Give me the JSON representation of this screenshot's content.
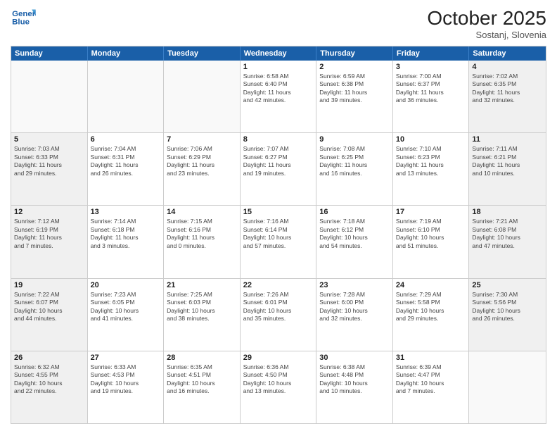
{
  "header": {
    "logo_line1": "General",
    "logo_line2": "Blue",
    "month": "October 2025",
    "location": "Sostanj, Slovenia"
  },
  "weekdays": [
    "Sunday",
    "Monday",
    "Tuesday",
    "Wednesday",
    "Thursday",
    "Friday",
    "Saturday"
  ],
  "weeks": [
    [
      {
        "day": "",
        "info": ""
      },
      {
        "day": "",
        "info": ""
      },
      {
        "day": "",
        "info": ""
      },
      {
        "day": "1",
        "info": "Sunrise: 6:58 AM\nSunset: 6:40 PM\nDaylight: 11 hours\nand 42 minutes."
      },
      {
        "day": "2",
        "info": "Sunrise: 6:59 AM\nSunset: 6:38 PM\nDaylight: 11 hours\nand 39 minutes."
      },
      {
        "day": "3",
        "info": "Sunrise: 7:00 AM\nSunset: 6:37 PM\nDaylight: 11 hours\nand 36 minutes."
      },
      {
        "day": "4",
        "info": "Sunrise: 7:02 AM\nSunset: 6:35 PM\nDaylight: 11 hours\nand 32 minutes."
      }
    ],
    [
      {
        "day": "5",
        "info": "Sunrise: 7:03 AM\nSunset: 6:33 PM\nDaylight: 11 hours\nand 29 minutes."
      },
      {
        "day": "6",
        "info": "Sunrise: 7:04 AM\nSunset: 6:31 PM\nDaylight: 11 hours\nand 26 minutes."
      },
      {
        "day": "7",
        "info": "Sunrise: 7:06 AM\nSunset: 6:29 PM\nDaylight: 11 hours\nand 23 minutes."
      },
      {
        "day": "8",
        "info": "Sunrise: 7:07 AM\nSunset: 6:27 PM\nDaylight: 11 hours\nand 19 minutes."
      },
      {
        "day": "9",
        "info": "Sunrise: 7:08 AM\nSunset: 6:25 PM\nDaylight: 11 hours\nand 16 minutes."
      },
      {
        "day": "10",
        "info": "Sunrise: 7:10 AM\nSunset: 6:23 PM\nDaylight: 11 hours\nand 13 minutes."
      },
      {
        "day": "11",
        "info": "Sunrise: 7:11 AM\nSunset: 6:21 PM\nDaylight: 11 hours\nand 10 minutes."
      }
    ],
    [
      {
        "day": "12",
        "info": "Sunrise: 7:12 AM\nSunset: 6:19 PM\nDaylight: 11 hours\nand 7 minutes."
      },
      {
        "day": "13",
        "info": "Sunrise: 7:14 AM\nSunset: 6:18 PM\nDaylight: 11 hours\nand 3 minutes."
      },
      {
        "day": "14",
        "info": "Sunrise: 7:15 AM\nSunset: 6:16 PM\nDaylight: 11 hours\nand 0 minutes."
      },
      {
        "day": "15",
        "info": "Sunrise: 7:16 AM\nSunset: 6:14 PM\nDaylight: 10 hours\nand 57 minutes."
      },
      {
        "day": "16",
        "info": "Sunrise: 7:18 AM\nSunset: 6:12 PM\nDaylight: 10 hours\nand 54 minutes."
      },
      {
        "day": "17",
        "info": "Sunrise: 7:19 AM\nSunset: 6:10 PM\nDaylight: 10 hours\nand 51 minutes."
      },
      {
        "day": "18",
        "info": "Sunrise: 7:21 AM\nSunset: 6:08 PM\nDaylight: 10 hours\nand 47 minutes."
      }
    ],
    [
      {
        "day": "19",
        "info": "Sunrise: 7:22 AM\nSunset: 6:07 PM\nDaylight: 10 hours\nand 44 minutes."
      },
      {
        "day": "20",
        "info": "Sunrise: 7:23 AM\nSunset: 6:05 PM\nDaylight: 10 hours\nand 41 minutes."
      },
      {
        "day": "21",
        "info": "Sunrise: 7:25 AM\nSunset: 6:03 PM\nDaylight: 10 hours\nand 38 minutes."
      },
      {
        "day": "22",
        "info": "Sunrise: 7:26 AM\nSunset: 6:01 PM\nDaylight: 10 hours\nand 35 minutes."
      },
      {
        "day": "23",
        "info": "Sunrise: 7:28 AM\nSunset: 6:00 PM\nDaylight: 10 hours\nand 32 minutes."
      },
      {
        "day": "24",
        "info": "Sunrise: 7:29 AM\nSunset: 5:58 PM\nDaylight: 10 hours\nand 29 minutes."
      },
      {
        "day": "25",
        "info": "Sunrise: 7:30 AM\nSunset: 5:56 PM\nDaylight: 10 hours\nand 26 minutes."
      }
    ],
    [
      {
        "day": "26",
        "info": "Sunrise: 6:32 AM\nSunset: 4:55 PM\nDaylight: 10 hours\nand 22 minutes."
      },
      {
        "day": "27",
        "info": "Sunrise: 6:33 AM\nSunset: 4:53 PM\nDaylight: 10 hours\nand 19 minutes."
      },
      {
        "day": "28",
        "info": "Sunrise: 6:35 AM\nSunset: 4:51 PM\nDaylight: 10 hours\nand 16 minutes."
      },
      {
        "day": "29",
        "info": "Sunrise: 6:36 AM\nSunset: 4:50 PM\nDaylight: 10 hours\nand 13 minutes."
      },
      {
        "day": "30",
        "info": "Sunrise: 6:38 AM\nSunset: 4:48 PM\nDaylight: 10 hours\nand 10 minutes."
      },
      {
        "day": "31",
        "info": "Sunrise: 6:39 AM\nSunset: 4:47 PM\nDaylight: 10 hours\nand 7 minutes."
      },
      {
        "day": "",
        "info": ""
      }
    ]
  ]
}
